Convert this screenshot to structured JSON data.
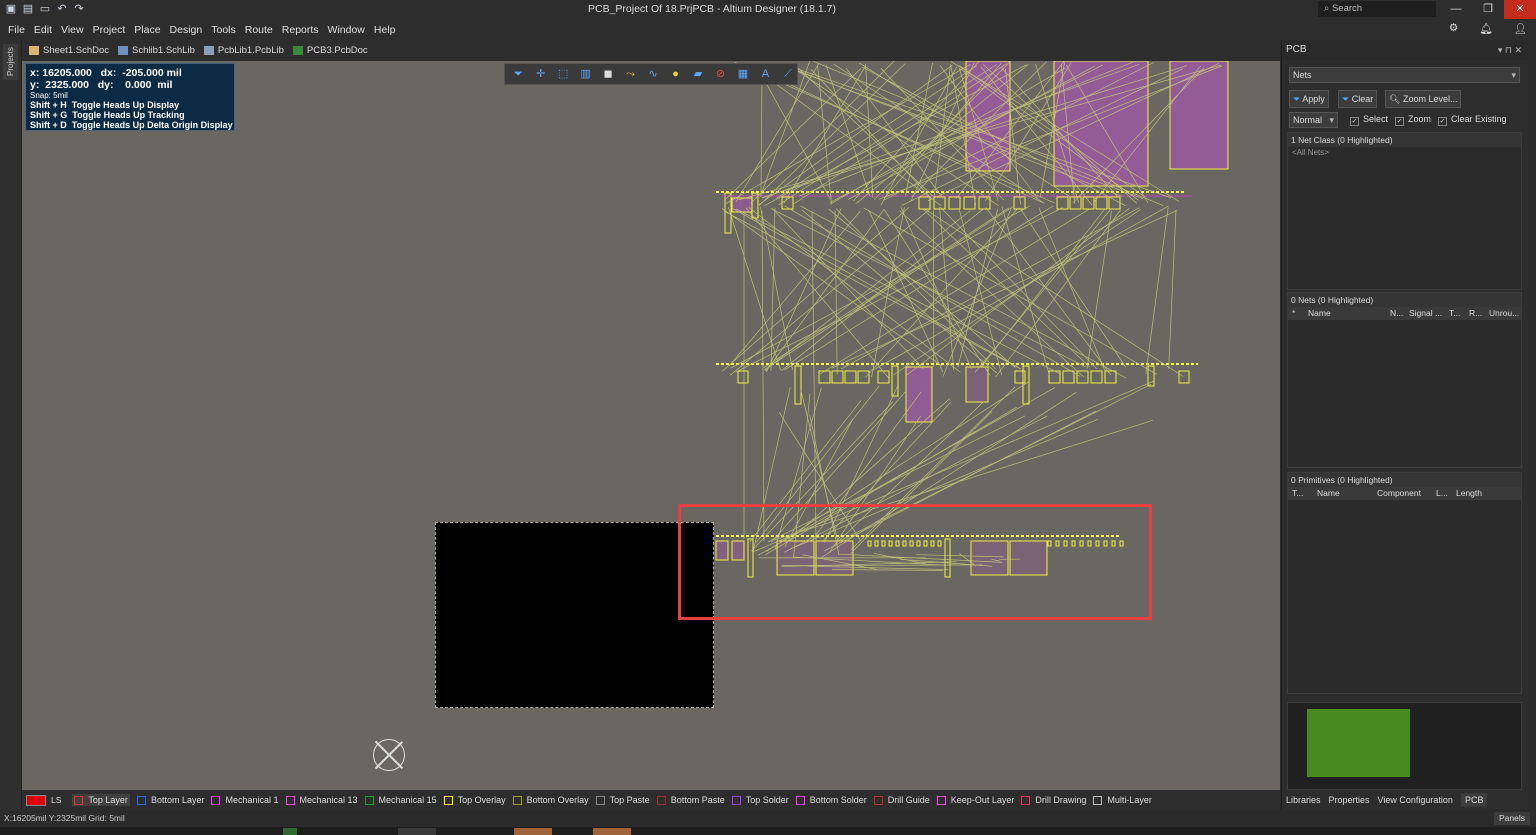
{
  "window": {
    "title": "PCB_Project Of 18.PrjPCB - Altium Designer (18.1.7)",
    "search_placeholder": "Search",
    "quick_access_icons": [
      "save-icon",
      "save-all-icon",
      "open-icon",
      "undo-icon",
      "redo-icon"
    ]
  },
  "menu": [
    "File",
    "Edit",
    "View",
    "Project",
    "Place",
    "Design",
    "Tools",
    "Route",
    "Reports",
    "Window",
    "Help"
  ],
  "side_tab": "Projects",
  "doc_tabs": [
    {
      "label": "Sheet1.SchDoc",
      "icon": "schematic-icon"
    },
    {
      "label": "Schlib1.SchLib",
      "icon": "schlib-icon"
    },
    {
      "label": "PcbLib1.PcbLib",
      "icon": "pcblib-icon"
    },
    {
      "label": "PCB3.PcbDoc",
      "icon": "pcbdoc-icon"
    }
  ],
  "hud": {
    "line1": "x: 16205.000   dx:  -205.000 mil",
    "line2": "y:  2325.000   dy:    0.000  mil",
    "line3": "Snap: 5mil",
    "line4": "Shift + H  Toggle Heads Up Display",
    "line5": "Shift + G  Toggle Heads Up Tracking",
    "line6": "Shift + D  Toggle Heads Up Delta Origin Display"
  },
  "pcb_panel": {
    "title": "PCB",
    "mode": "Nets",
    "buttons": {
      "apply": "Apply",
      "clear": "Clear",
      "zoom": "Zoom Level..."
    },
    "highlight_mode": "Normal",
    "checks": {
      "select": "Select",
      "zoom": "Zoom",
      "clear_existing": "Clear Existing"
    },
    "net_class_header": "1 Net Class (0 Highlighted)",
    "net_class_item": "<All Nets>",
    "nets_header": "0 Nets (0 Highlighted)",
    "nets_cols": [
      "*",
      "Name",
      "N...",
      "Signal ...",
      "T...",
      "R...",
      "Unrou..."
    ],
    "prims_header": "0 Primitives (0 Highlighted)",
    "prims_cols": [
      "T...",
      "Name",
      "Component",
      "L...",
      "Length"
    ],
    "bottom_tabs": [
      "Libraries",
      "Properties",
      "View Configuration",
      "PCB"
    ]
  },
  "layers": {
    "ls_label": "LS",
    "items": [
      {
        "name": "Top Layer",
        "color": "#ff3030"
      },
      {
        "name": "Bottom Layer",
        "color": "#3060ff"
      },
      {
        "name": "Mechanical 1",
        "color": "#ff40ff"
      },
      {
        "name": "Mechanical 13",
        "color": "#ff40ff"
      },
      {
        "name": "Mechanical 15",
        "color": "#20a020"
      },
      {
        "name": "Top Overlay",
        "color": "#ffff00"
      },
      {
        "name": "Bottom Overlay",
        "color": "#a0a020"
      },
      {
        "name": "Top Paste",
        "color": "#888888"
      },
      {
        "name": "Bottom Paste",
        "color": "#a03030"
      },
      {
        "name": "Top Solder",
        "color": "#a040ff"
      },
      {
        "name": "Bottom Solder",
        "color": "#ff40ff"
      },
      {
        "name": "Drill Guide",
        "color": "#c03030"
      },
      {
        "name": "Keep-Out Layer",
        "color": "#ff40ff"
      },
      {
        "name": "Drill Drawing",
        "color": "#ff3060"
      },
      {
        "name": "Multi-Layer",
        "color": "#c0c0c0"
      }
    ]
  },
  "status": {
    "coords": "X:16205mil Y:2325mil   Grid: 5mil",
    "panels": "Panels"
  },
  "colors": {
    "canvas": "#6a6763",
    "ratsnest": "#c8c87a",
    "overlay": "#ffff40",
    "component_fill": "#9a5aa0",
    "highlight_box": "#e84040"
  }
}
